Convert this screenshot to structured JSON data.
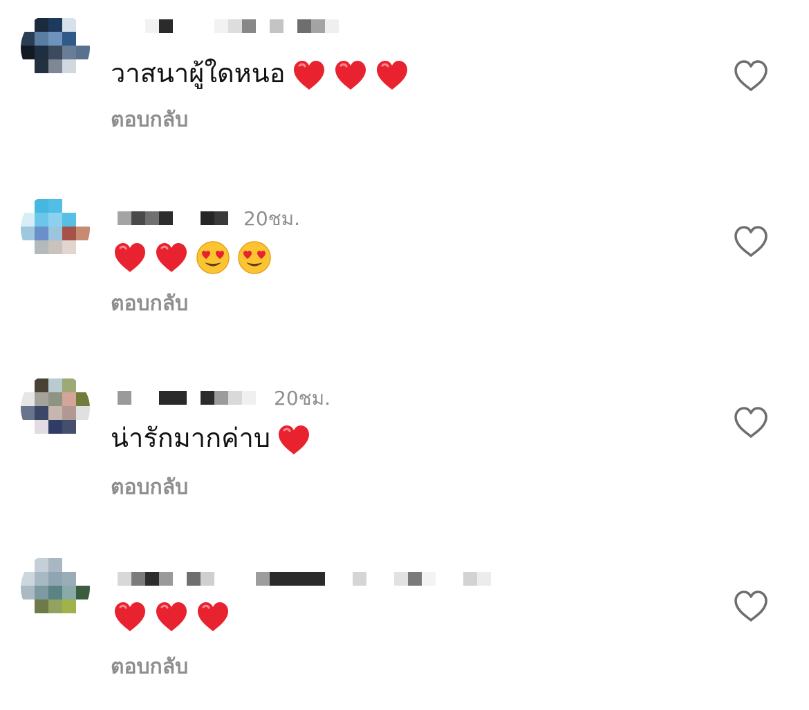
{
  "comments": [
    {
      "meta_tail": "",
      "text": "วาสนาผู้ใดหนอ",
      "emojis": [
        "heart",
        "heart",
        "heart"
      ],
      "reply_label": "ตอบกลับ",
      "avatar": [
        "#ffffff",
        "#1b2a3d",
        "#1d3a5c",
        "#d6e1ec",
        "#ffffff",
        "#2b3d52",
        "#5a7ea3",
        "#6e94be",
        "#2f5a88",
        "#ffffff",
        "#121a24",
        "#1f2e40",
        "#3b4a5c",
        "#6a7d96",
        "#5a7090",
        "#ffffff",
        "#22303f",
        "#7d8796",
        "#d1d8e0",
        "#ffffff"
      ]
    },
    {
      "meta_tail": "20ชม.",
      "text": "",
      "emojis": [
        "heart",
        "heart",
        "hearteyes",
        "hearteyes"
      ],
      "reply_label": "ตอบกลับ",
      "avatar": [
        "#ffffff",
        "#45b7e0",
        "#52bde6",
        "#ffffff",
        "#ffffff",
        "#d8edf6",
        "#6cc6ea",
        "#8cd2ef",
        "#56bfe6",
        "#ffffff",
        "#9fc8de",
        "#6b8fc8",
        "#9bc4dd",
        "#a5524a",
        "#c78a72",
        "#ffffff",
        "#b4b9bc",
        "#c9c2bd",
        "#e0d5cf",
        "#ffffff"
      ]
    },
    {
      "meta_tail": "20ชม.",
      "text": "น่ารักมากค่าบ",
      "emojis": [
        "heart"
      ],
      "reply_label": "ตอบกลับ",
      "avatar": [
        "#ffffff",
        "#4a4136",
        "#b9cbd1",
        "#9daa74",
        "#ffffff",
        "#e6e6e6",
        "#a3a39b",
        "#8f9482",
        "#d3a59a",
        "#717b3a",
        "#67748c",
        "#3c4669",
        "#c7b6ae",
        "#b19893",
        "#e0e0e0",
        "#ffffff",
        "#e2dbe3",
        "#2f3d66",
        "#434f6c",
        "#ffffff"
      ]
    },
    {
      "meta_tail": "",
      "text": "",
      "emojis": [
        "heart",
        "heart",
        "heart"
      ],
      "reply_label": "ตอบกลับ",
      "avatar": [
        "#ffffff",
        "#c4cfd7",
        "#a8b7c1",
        "#ffffff",
        "#ffffff",
        "#cbd6dd",
        "#a8b9c4",
        "#8fa6b2",
        "#9aacb7",
        "#ffffff",
        "#a9bac2",
        "#7d9aa2",
        "#5a8383",
        "#8aaaa8",
        "#3c5c3e",
        "#ffffff",
        "#6e7a47",
        "#91a35f",
        "#a0b24a",
        "#ffffff"
      ]
    }
  ],
  "icons": {
    "like": "heart-outline-icon"
  },
  "colors": {
    "meta": "#8e8e8e",
    "heart": "#e8232f"
  }
}
